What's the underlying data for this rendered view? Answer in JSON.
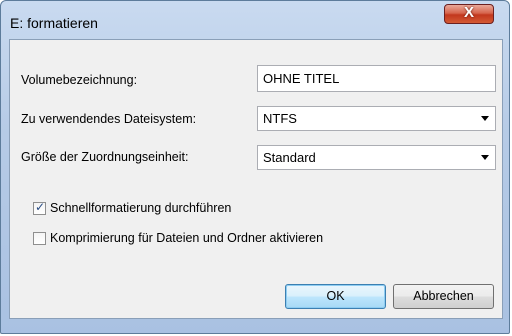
{
  "window": {
    "title": "E: formatieren",
    "close_label": "X"
  },
  "form": {
    "volume_label": "Volumebezeichnung:",
    "volume_value": "OHNE TITEL",
    "filesystem_label": "Zu verwendendes Dateisystem:",
    "filesystem_value": "NTFS",
    "allocation_label": "Größe der Zuordnungseinheit:",
    "allocation_value": "Standard"
  },
  "options": {
    "quick_format_label": "Schnellformatierung durchführen",
    "quick_format_checked": true,
    "compress_label": "Komprimierung für Dateien und Ordner aktivieren",
    "compress_checked": false
  },
  "buttons": {
    "ok_label": "OK",
    "cancel_label": "Abbrechen"
  }
}
